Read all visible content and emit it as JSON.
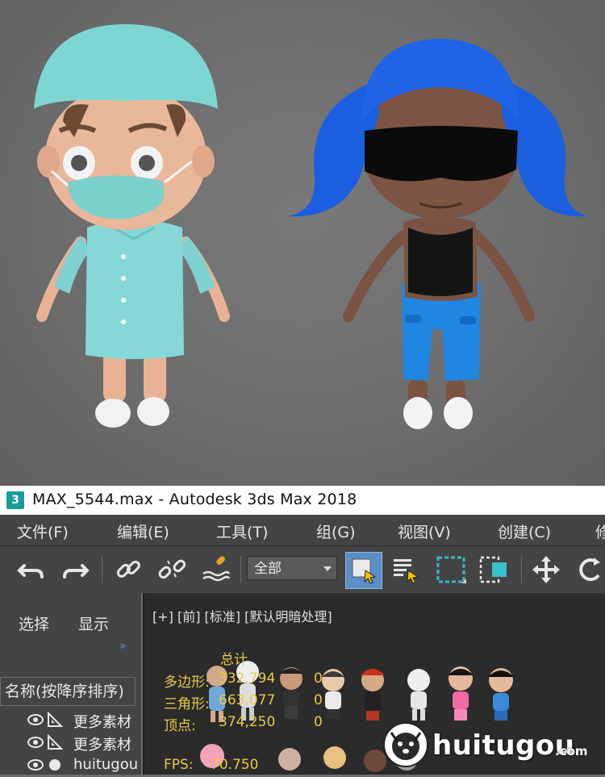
{
  "window": {
    "title": "MAX_5544.max - Autodesk 3ds Max 2018",
    "app_icon_label": "3"
  },
  "menu": [
    "文件(F)",
    "编辑(E)",
    "工具(T)",
    "组(G)",
    "视图(V)",
    "创建(C)",
    "修"
  ],
  "toolbar": {
    "filter_value": "全部"
  },
  "scene_explorer": {
    "tabs": [
      "选择",
      "显示"
    ],
    "column_header": "名称(按降序排序)",
    "rows": [
      {
        "label": "更多素材",
        "type": "group"
      },
      {
        "label": "更多素材",
        "type": "group"
      },
      {
        "label": "huitugou",
        "type": "object"
      }
    ]
  },
  "viewport": {
    "label": "[+] [前] [标准] [默认明暗处理]",
    "stats": {
      "total_label": "总计",
      "rows": [
        {
          "label": "多边形:",
          "value": "332,794",
          "selected": "0"
        },
        {
          "label": "三角形:",
          "value": "663,077",
          "selected": "0"
        },
        {
          "label": "顶点:",
          "value": "374,250",
          "selected": "0"
        }
      ],
      "fps_label": "FPS:",
      "fps_value": "70.750"
    }
  },
  "watermark": {
    "text": "huitugou",
    "suffix": ".com"
  },
  "colors": {
    "ui_bg": "#444444",
    "viewport_bg": "#2b2b2b",
    "stat_text": "#e8c84a",
    "select_active": "#5b8fc7",
    "render_bg": "#6e6e6e"
  }
}
